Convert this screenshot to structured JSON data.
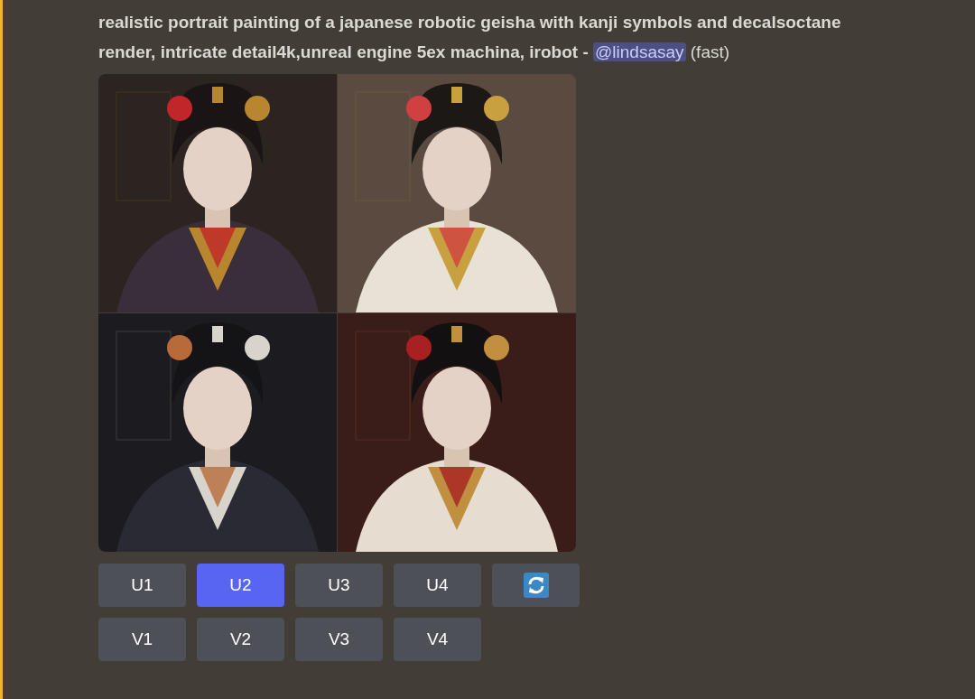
{
  "message": {
    "prompt": "realistic portrait painting of a japanese robotic geisha with kanji symbols and decalsoctane render, intricate detail4k,unreal engine 5ex machina, irobot -",
    "mention": "@lindsasay",
    "speed": "(fast)"
  },
  "image_grid": [
    {
      "kind": "picture"
    },
    {
      "kind": "picture"
    },
    {
      "kind": "picture"
    },
    {
      "kind": "picture"
    }
  ],
  "button_rows": [
    [
      {
        "kind": "text",
        "label": "U1",
        "selected": false
      },
      {
        "kind": "text",
        "label": "U2",
        "selected": true
      },
      {
        "kind": "text",
        "label": "U3",
        "selected": false
      },
      {
        "kind": "text",
        "label": "U4",
        "selected": false
      },
      {
        "kind": "refresh",
        "selected": false
      }
    ],
    [
      {
        "kind": "text",
        "label": "V1",
        "selected": false
      },
      {
        "kind": "text",
        "label": "V2",
        "selected": false
      },
      {
        "kind": "text",
        "label": "V3",
        "selected": false
      },
      {
        "kind": "text",
        "label": "V4",
        "selected": false
      }
    ]
  ]
}
